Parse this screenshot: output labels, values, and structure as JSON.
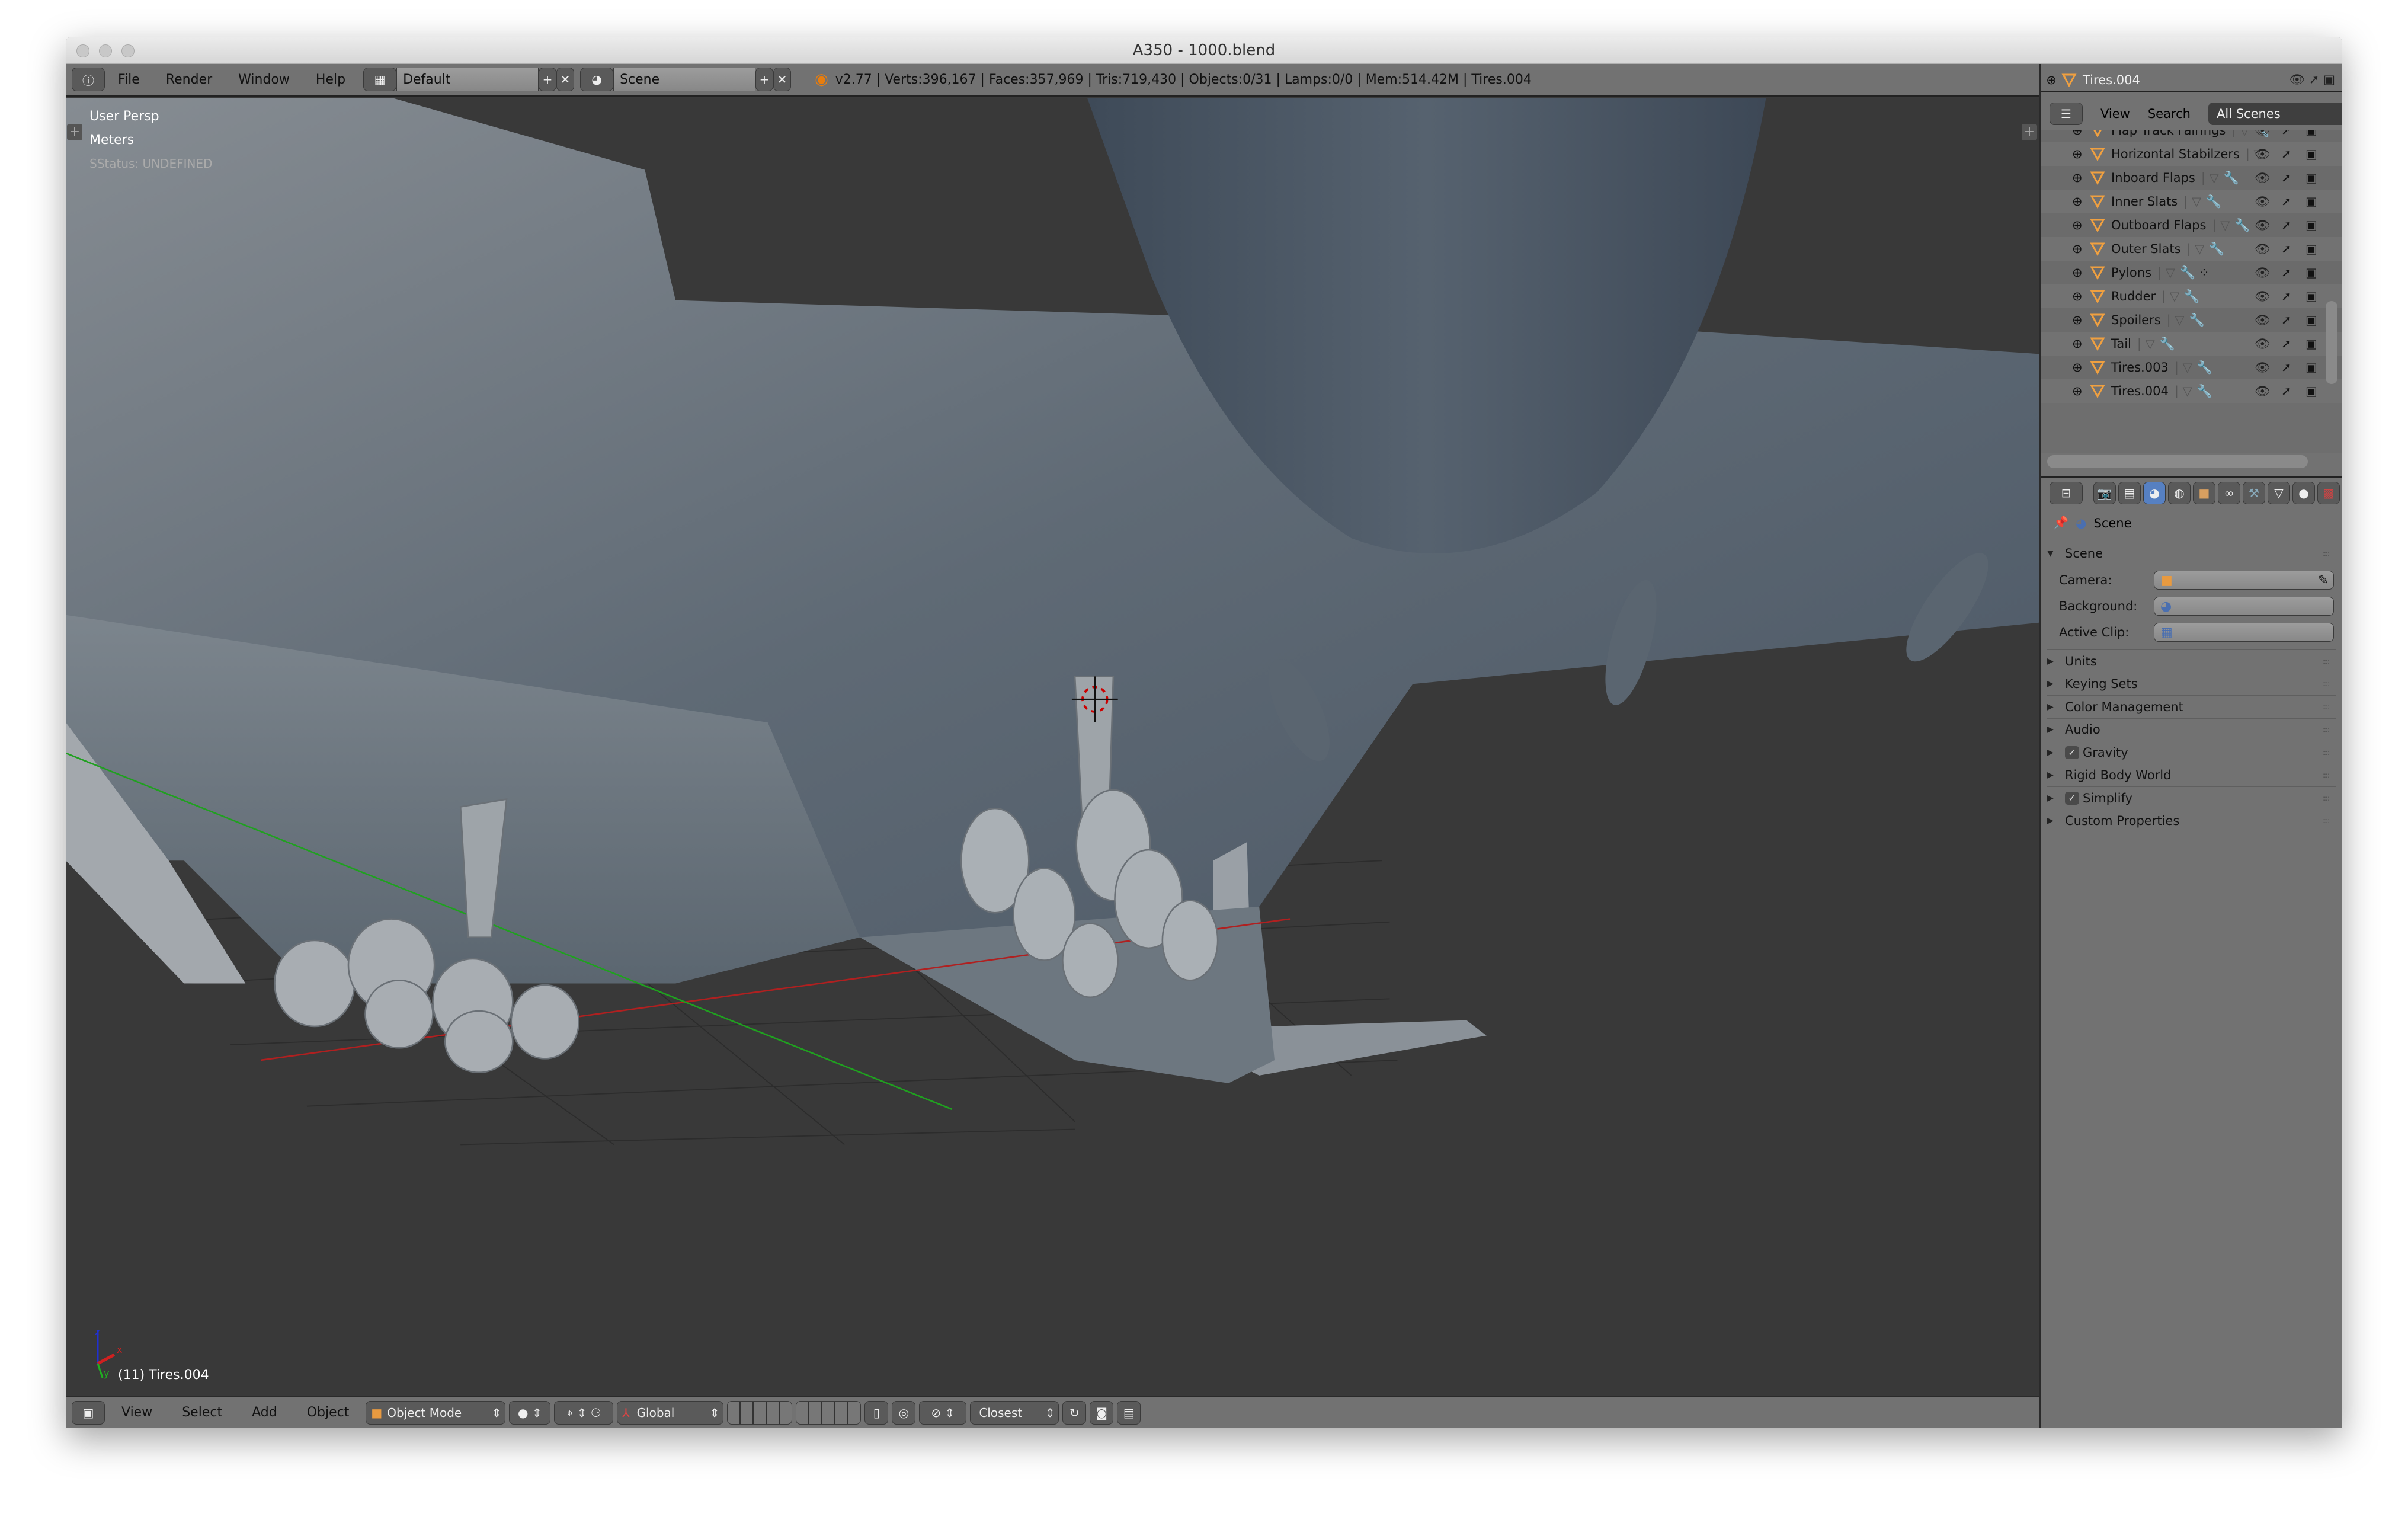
{
  "window": {
    "title": "A350 - 1000.blend"
  },
  "top_header": {
    "menus": [
      "File",
      "Render",
      "Window",
      "Help"
    ],
    "screen_layout": "Default",
    "scene": "Scene",
    "stats": "v2.77 | Verts:396,167 | Faces:357,969 | Tris:719,430 | Objects:0/31 | Lamps:0/0 | Mem:514.42M | Tires.004"
  },
  "viewport": {
    "view_name": "User Persp",
    "units": "Meters",
    "status": "SStatus: UNDEFINED",
    "active_object": "(11) Tires.004",
    "axes": {
      "x": "x",
      "y": "y",
      "z": "z"
    },
    "axis_colors": {
      "x": "#d02020",
      "y": "#20b020",
      "z": "#2030d0"
    }
  },
  "bottom_header": {
    "menus": [
      "View",
      "Select",
      "Add",
      "Object"
    ],
    "mode": "Object Mode",
    "orientation": "Global",
    "snap_target": "Closest"
  },
  "outliner": {
    "active": "Tires.004",
    "tabs": {
      "view": "View",
      "search": "Search",
      "display": "All Scenes"
    },
    "items": [
      {
        "name": "Flap Track Fairings",
        "modifier": true,
        "extra": false
      },
      {
        "name": "Horizontal Stabilzers",
        "modifier": false,
        "extra": false
      },
      {
        "name": "Inboard Flaps",
        "modifier": true,
        "extra": false
      },
      {
        "name": "Inner Slats",
        "modifier": true,
        "extra": false
      },
      {
        "name": "Outboard Flaps",
        "modifier": true,
        "extra": false
      },
      {
        "name": "Outer Slats",
        "modifier": true,
        "extra": false
      },
      {
        "name": "Pylons",
        "modifier": true,
        "extra": true
      },
      {
        "name": "Rudder",
        "modifier": true,
        "extra": false
      },
      {
        "name": "Spoilers",
        "modifier": true,
        "extra": false
      },
      {
        "name": "Tail",
        "modifier": true,
        "extra": false
      },
      {
        "name": "Tires.003",
        "modifier": true,
        "extra": false
      },
      {
        "name": "Tires.004",
        "modifier": true,
        "extra": false
      }
    ]
  },
  "properties": {
    "context": "Scene",
    "panel_title": "Scene",
    "fields": [
      {
        "label": "Camera:"
      },
      {
        "label": "Background:"
      },
      {
        "label": "Active Clip:"
      }
    ],
    "panels": [
      {
        "label": "Units",
        "checkbox": false
      },
      {
        "label": "Keying Sets",
        "checkbox": false
      },
      {
        "label": "Color Management",
        "checkbox": false
      },
      {
        "label": "Audio",
        "checkbox": false
      },
      {
        "label": "Gravity",
        "checkbox": true,
        "checked": true
      },
      {
        "label": "Rigid Body World",
        "checkbox": false
      },
      {
        "label": "Simplify",
        "checkbox": true,
        "checked": true
      },
      {
        "label": "Custom Properties",
        "checkbox": false
      }
    ]
  },
  "colors": {
    "accent": "#5680c2",
    "mesh_icon": "#f0a040"
  }
}
